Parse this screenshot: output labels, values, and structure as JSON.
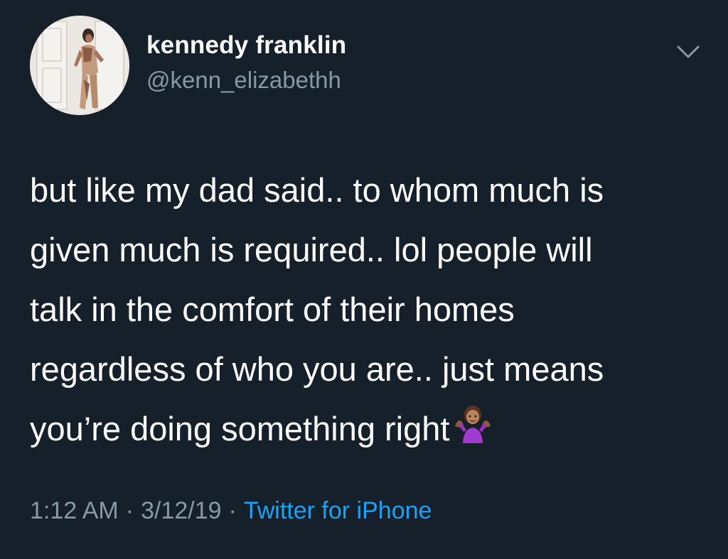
{
  "tweet": {
    "author": {
      "display_name": "kennedy franklin",
      "handle": "@kenn_elizabethh",
      "avatar": "profile-photo"
    },
    "text": "but like my dad said.. to whom much is\ngiven much is required.. lol people will\ntalk in the comfort of their homes\nregardless of who you are.. just means\nyou’re doing something right",
    "emoji": "person-shrugging-emoji",
    "time": "1:12 AM",
    "date": "3/12/19",
    "separator": "·",
    "source": "Twitter for iPhone",
    "menu_icon": "chevron-down-icon"
  },
  "colors": {
    "background": "#15202b",
    "primary_text": "#ffffff",
    "secondary_text": "#8899a6",
    "link": "#1da1f2"
  }
}
